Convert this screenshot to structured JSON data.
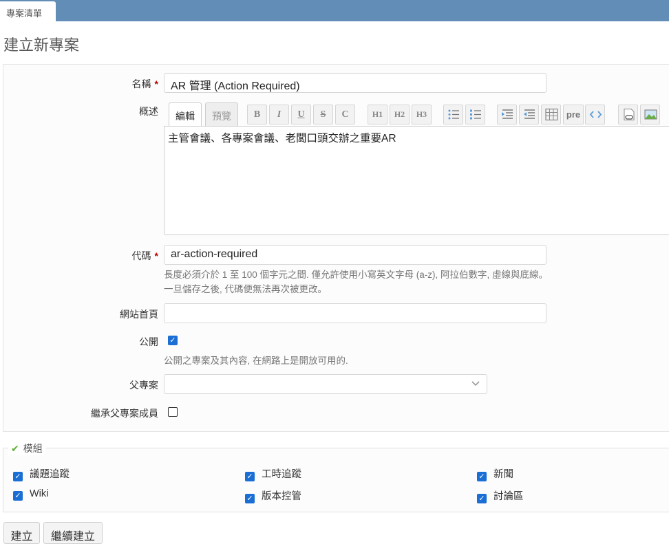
{
  "nav": {
    "tab_label": "專案清單"
  },
  "page": {
    "title": "建立新專案"
  },
  "form": {
    "name": {
      "label": "名稱",
      "required_mark": "*",
      "value": "AR 管理 (Action Required)"
    },
    "description": {
      "label": "概述",
      "tabs": [
        "編輯",
        "預覽"
      ],
      "toolbar": [
        "B",
        "I",
        "U",
        "S",
        "C",
        "H1",
        "H2",
        "H3",
        "ul",
        "ol",
        "indent",
        "outdent",
        "table",
        "pre",
        "code",
        "link",
        "image"
      ],
      "value": "主管會議、各專案會議、老闆口頭交辦之重要AR"
    },
    "identifier": {
      "label": "代碼",
      "required_mark": "*",
      "value": "ar-action-required",
      "hint_line1": "長度必須介於 1 至 100 個字元之間. 僅允許使用小寫英文字母 (a-z), 阿拉伯數字, 虛線與底線。",
      "hint_line2": "一旦儲存之後, 代碼便無法再次被更改。"
    },
    "homepage": {
      "label": "網站首頁",
      "value": ""
    },
    "public": {
      "label": "公開",
      "checked": true,
      "hint": "公開之專案及其內容, 在網路上是開放可用的."
    },
    "parent": {
      "label": "父專案",
      "value": ""
    },
    "inherit_members": {
      "label": "繼承父專案成員",
      "checked": false
    }
  },
  "modules": {
    "legend": "模組",
    "items": [
      {
        "label": "議題追蹤",
        "checked": true
      },
      {
        "label": "工時追蹤",
        "checked": true
      },
      {
        "label": "新聞",
        "checked": true
      },
      {
        "label": "Wiki",
        "checked": true
      },
      {
        "label": "版本控管",
        "checked": true
      },
      {
        "label": "討論區",
        "checked": true
      }
    ]
  },
  "actions": {
    "create_label": "建立",
    "create_continue_label": "繼續建立"
  },
  "colors": {
    "topbar": "#628db6",
    "checkbox": "#1b6fd4",
    "required": "#bb0000"
  }
}
